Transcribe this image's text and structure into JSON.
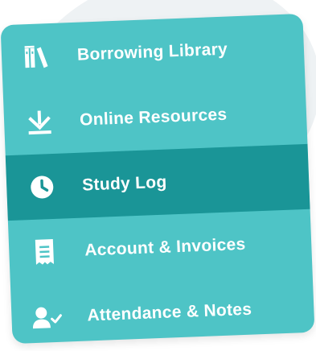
{
  "menu": {
    "items": [
      {
        "label": "Borrowing Library",
        "icon": "books-icon",
        "active": false
      },
      {
        "label": "Online Resources",
        "icon": "download-icon",
        "active": false
      },
      {
        "label": "Study Log",
        "icon": "clock-icon",
        "active": true
      },
      {
        "label": "Account & Invoices",
        "icon": "receipt-icon",
        "active": false
      },
      {
        "label": "Attendance & Notes",
        "icon": "user-check-icon",
        "active": false
      }
    ]
  },
  "colors": {
    "menu_background": "#4ec4c6",
    "active_background": "#1a9597",
    "text": "#ffffff"
  }
}
